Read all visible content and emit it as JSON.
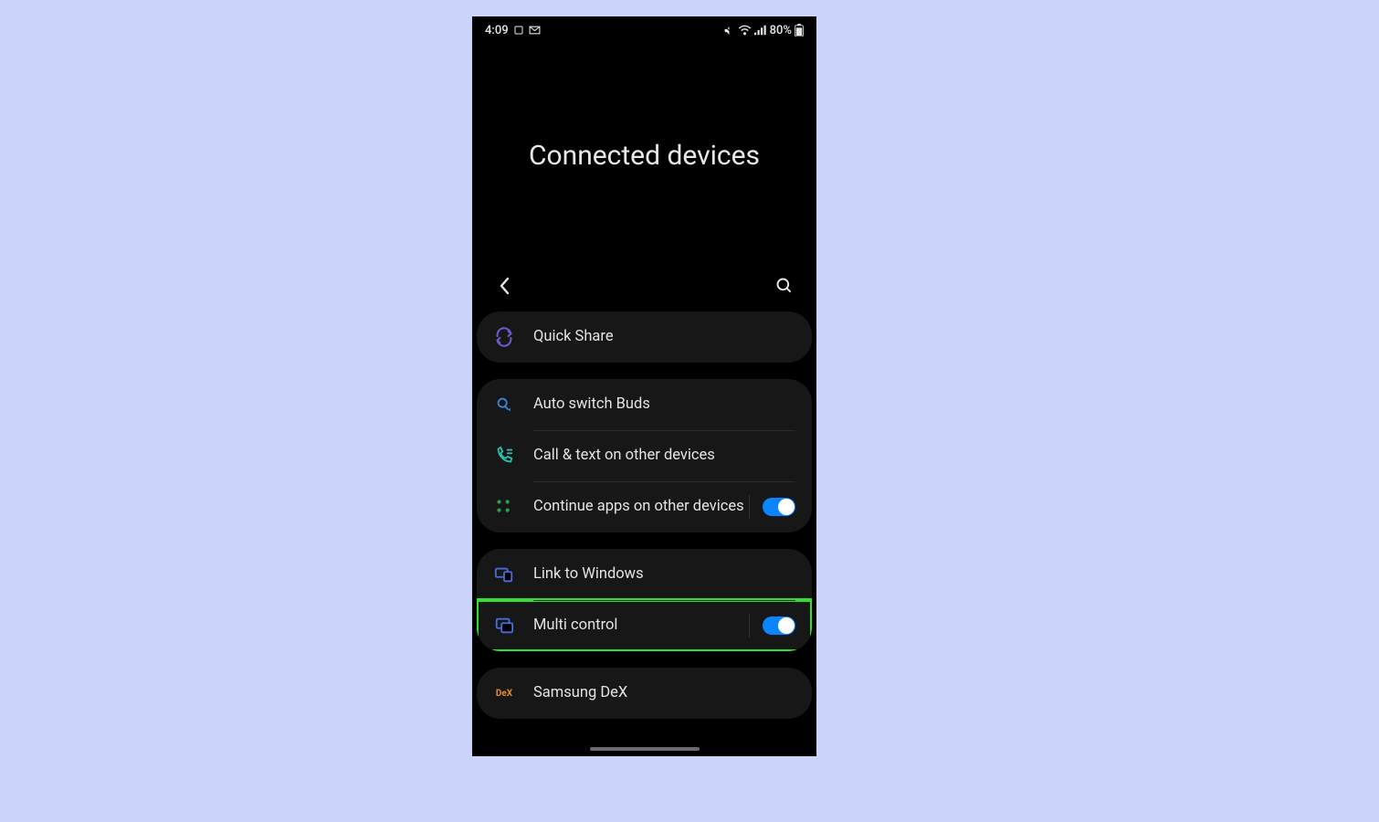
{
  "statusbar": {
    "time": "4:09",
    "battery": "80%"
  },
  "page": {
    "title": "Connected devices"
  },
  "items": {
    "quick_share": {
      "label": "Quick Share"
    },
    "auto_switch": {
      "label": "Auto switch Buds"
    },
    "call_text": {
      "label": "Call & text on other devices"
    },
    "continue_apps": {
      "label": "Continue apps on other devices",
      "toggle": true,
      "on": true
    },
    "link_windows": {
      "label": "Link to Windows"
    },
    "multi_control": {
      "label": "Multi control",
      "toggle": true,
      "on": true,
      "highlighted": true
    },
    "samsung_dex": {
      "label": "Samsung DeX",
      "dex_badge": "DeX"
    }
  }
}
